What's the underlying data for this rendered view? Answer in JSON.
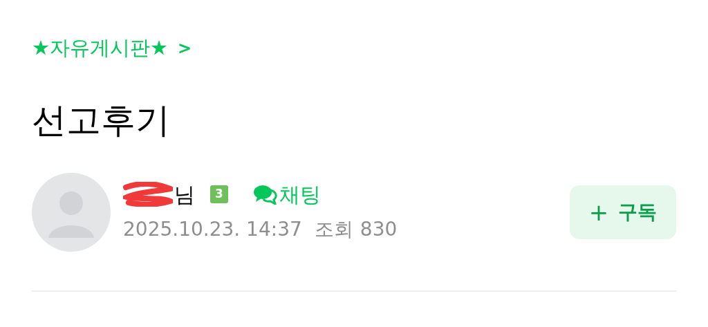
{
  "board": {
    "label": "★자유게시판★",
    "chevron": ">"
  },
  "title": "선고후기",
  "author": {
    "name": "님",
    "redacted": true,
    "level": "3",
    "chat": "채팅",
    "date": "2025.10.23. 14:37",
    "views_label": "조회",
    "views": "830"
  },
  "subscribe": {
    "icon": "+",
    "label": "구독"
  }
}
